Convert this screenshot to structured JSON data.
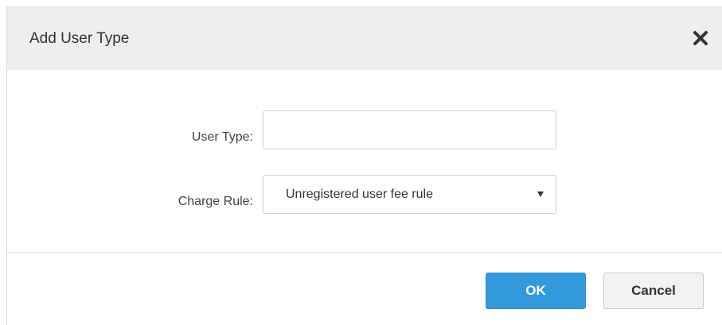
{
  "dialog": {
    "title": "Add User Type",
    "close_icon": "close-icon"
  },
  "form": {
    "user_type": {
      "label": "User Type:",
      "value": "",
      "placeholder": ""
    },
    "charge_rule": {
      "label": "Charge Rule:",
      "selected": "Unregistered user fee rule",
      "arrow_icon": "dropdown-arrow-icon"
    }
  },
  "footer": {
    "ok_label": "OK",
    "cancel_label": "Cancel"
  },
  "colors": {
    "header_bg": "#eeeeee",
    "primary_button": "#3399dd",
    "secondary_button": "#f2f2f2"
  }
}
